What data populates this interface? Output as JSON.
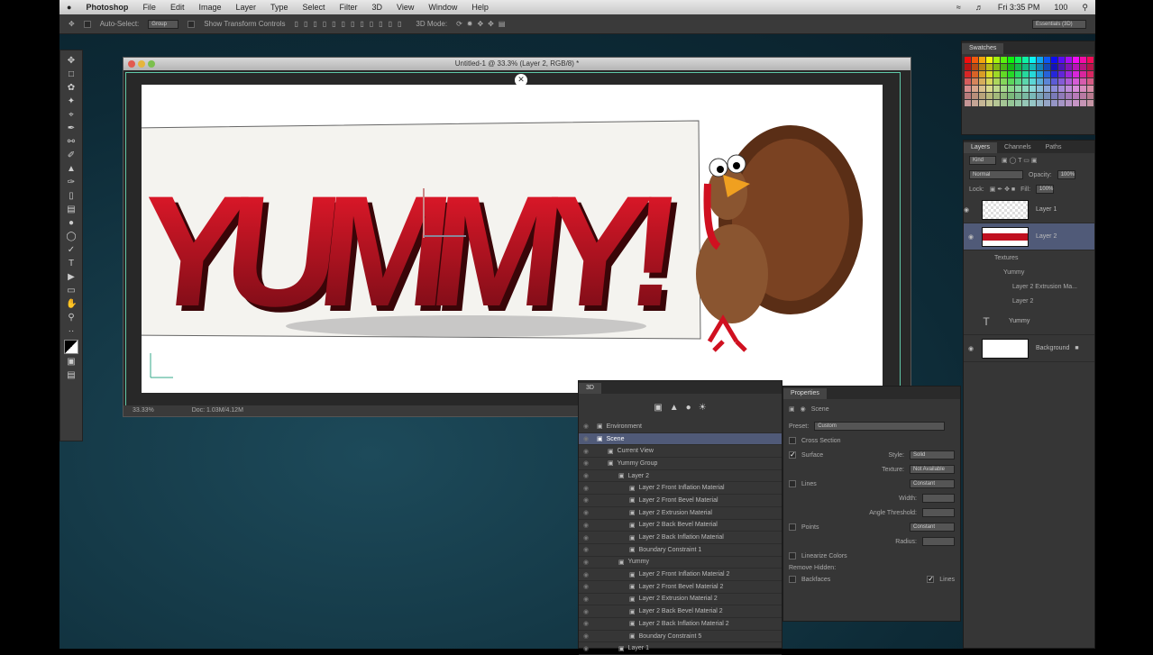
{
  "menubar": {
    "apple": "",
    "items": [
      "Photoshop",
      "File",
      "Edit",
      "Image",
      "Layer",
      "Type",
      "Select",
      "Filter",
      "3D",
      "View",
      "Window",
      "Help"
    ],
    "clock": "Fri 3:35 PM",
    "battery": "100"
  },
  "options": {
    "auto_select": "Auto-Select:",
    "auto_select_value": "Group",
    "show_transform": "Show Transform Controls",
    "mode_3d": "3D Mode:",
    "workspace": "Essentials (3D)"
  },
  "document": {
    "title": "Untitled-1 @ 33.3% (Layer 2, RGB/8) *",
    "zoom": "33.33%",
    "doc_info": "Doc: 1.03M/4.12M",
    "artwork_text": "YUMMY!"
  },
  "swatches": {
    "title": "Swatches"
  },
  "layers": {
    "tabs": [
      "Layers",
      "Channels",
      "Paths"
    ],
    "kind": "Kind",
    "blend": "Normal",
    "opacity_label": "Opacity:",
    "opacity": "100%",
    "lock_label": "Lock:",
    "fill_label": "Fill:",
    "fill": "100%",
    "items": [
      {
        "name": "Layer 1"
      },
      {
        "name": "Layer 2"
      },
      {
        "name": "Textures"
      },
      {
        "name": "Yummy"
      },
      {
        "name": "Layer 2 Extrusion Ma..."
      },
      {
        "name": "Layer 2"
      },
      {
        "name": "Yummy"
      },
      {
        "name": "Background"
      }
    ]
  },
  "panel3d": {
    "title": "3D",
    "rows": [
      {
        "name": "Environment",
        "indent": 0
      },
      {
        "name": "Scene",
        "indent": 0,
        "selected": true
      },
      {
        "name": "Current View",
        "indent": 1
      },
      {
        "name": "Yummy Group",
        "indent": 1
      },
      {
        "name": "Layer 2",
        "indent": 2
      },
      {
        "name": "Layer 2 Front Inflation Material",
        "indent": 3
      },
      {
        "name": "Layer 2 Front Bevel Material",
        "indent": 3
      },
      {
        "name": "Layer 2 Extrusion Material",
        "indent": 3
      },
      {
        "name": "Layer 2 Back Bevel Material",
        "indent": 3
      },
      {
        "name": "Layer 2 Back Inflation Material",
        "indent": 3
      },
      {
        "name": "Boundary Constraint 1",
        "indent": 3
      },
      {
        "name": "Yummy",
        "indent": 2
      },
      {
        "name": "Layer 2 Front Inflation Material 2",
        "indent": 3
      },
      {
        "name": "Layer 2 Front Bevel Material 2",
        "indent": 3
      },
      {
        "name": "Layer 2 Extrusion Material 2",
        "indent": 3
      },
      {
        "name": "Layer 2 Back Bevel Material 2",
        "indent": 3
      },
      {
        "name": "Layer 2 Back Inflation Material 2",
        "indent": 3
      },
      {
        "name": "Boundary Constraint 5",
        "indent": 3
      },
      {
        "name": "Layer 1",
        "indent": 2
      }
    ]
  },
  "properties": {
    "title": "Properties",
    "subtitle": "Scene",
    "preset_label": "Preset:",
    "preset": "Custom",
    "cross_section": "Cross Section",
    "surface": "Surface",
    "style_label": "Style:",
    "style": "Solid",
    "texture_label": "Texture:",
    "texture": "Not Available",
    "lines": "Lines",
    "lines_style": "Constant",
    "width_label": "Width:",
    "angle_label": "Angle Threshold:",
    "points": "Points",
    "points_style": "Constant",
    "radius_label": "Radius:",
    "linearize": "Linearize Colors",
    "remove_hidden": "Remove Hidden:",
    "backfaces": "Backfaces",
    "lines_chk": "Lines"
  }
}
